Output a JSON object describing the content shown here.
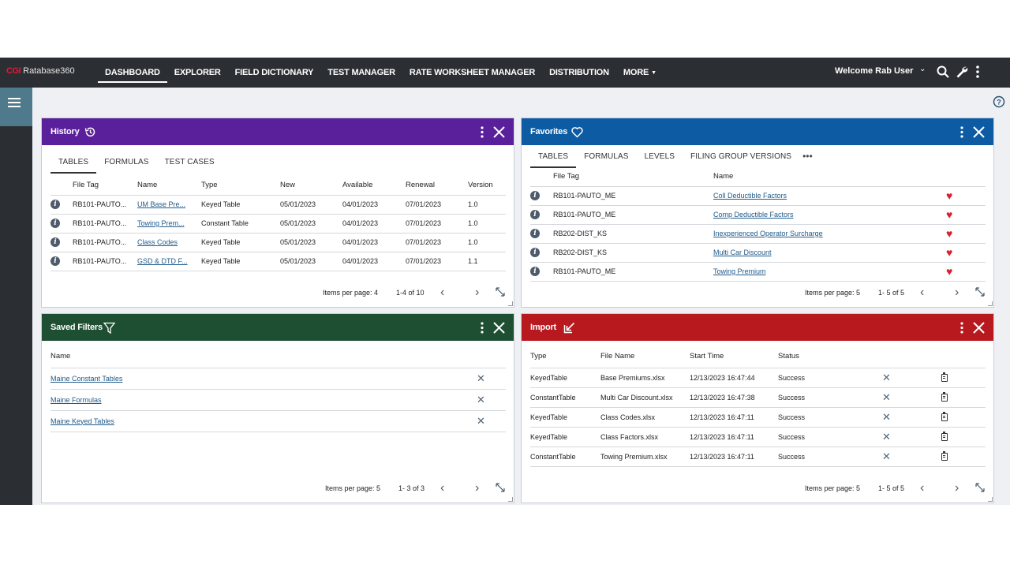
{
  "topbar": {
    "brand_logo": "CGI",
    "brand_name": "Ratabase360",
    "nav": [
      "DASHBOARD",
      "EXPLORER",
      "FIELD DICTIONARY",
      "TEST MANAGER",
      "RATE WORKSHEET MANAGER",
      "DISTRIBUTION",
      "MORE"
    ],
    "active_nav": "DASHBOARD",
    "welcome": "Welcome  Rab User"
  },
  "history": {
    "title": "History",
    "tabs": [
      "TABLES",
      "FORMULAS",
      "TEST CASES"
    ],
    "columns": [
      "File Tag",
      "Name",
      "Type",
      "New",
      "Available",
      "Renewal",
      "Version"
    ],
    "rows": [
      [
        "RB101-PAUTO...",
        "UM Base Pre...",
        "Keyed Table",
        "05/01/2023",
        "04/01/2023",
        "07/01/2023",
        "1.0"
      ],
      [
        "RB101-PAUTO...",
        "Towing Prem...",
        "Constant Table",
        "05/01/2023",
        "04/01/2023",
        "07/01/2023",
        "1.0"
      ],
      [
        "RB101-PAUTO...",
        "Class Codes",
        "Keyed Table",
        "05/01/2023",
        "04/01/2023",
        "07/01/2023",
        "1.0"
      ],
      [
        "RB101-PAUTO...",
        "GSD & DTD F...",
        "Keyed Table",
        "05/01/2023",
        "04/01/2023",
        "07/01/2023",
        "1.1"
      ]
    ],
    "items_per_page": "Items per page: 4",
    "range": "1-4 of 10"
  },
  "favorites": {
    "title": "Favorites",
    "tabs": [
      "TABLES",
      "FORMULAS",
      "LEVELS",
      "FILING GROUP VERSIONS"
    ],
    "more": "•••",
    "columns": [
      "File Tag",
      "Name"
    ],
    "rows": [
      [
        "RB101-PAUTO_ME",
        "Coll Deductible Factors"
      ],
      [
        "RB101-PAUTO_ME",
        "Comp Deductible Factors"
      ],
      [
        "RB202-DIST_KS",
        "Inexperienced Operator Surcharge"
      ],
      [
        "RB202-DIST_KS",
        "Multi Car Discount"
      ],
      [
        "RB101-PAUTO_ME",
        "Towing Premium"
      ]
    ],
    "items_per_page": "Items per page: 5",
    "range": "1- 5 of 5"
  },
  "saved_filters": {
    "title": "Saved Filters",
    "column": "Name",
    "rows": [
      "Maine Constant Tables",
      "Maine Formulas",
      "Maine Keyed Tables"
    ],
    "items_per_page": "Items per page: 5",
    "range": "1- 3 of 3"
  },
  "import": {
    "title": "Import",
    "columns": [
      "Type",
      "File Name",
      "Start Time",
      "Status"
    ],
    "rows": [
      [
        "KeyedTable",
        "Base Premiums.xlsx",
        "12/13/2023 16:47:44",
        "Success"
      ],
      [
        "ConstantTable",
        "Multi Car Discount.xlsx",
        "12/13/2023 16:47:38",
        "Success"
      ],
      [
        "KeyedTable",
        "Class Codes.xlsx",
        "12/13/2023 16:47:11",
        "Success"
      ],
      [
        "KeyedTable",
        "Class Factors.xlsx",
        "12/13/2023 16:47:11",
        "Success"
      ],
      [
        "ConstantTable",
        "Towing Premium.xlsx",
        "12/13/2023 16:47:11",
        "Success"
      ]
    ],
    "items_per_page": "Items per page: 5",
    "range": "1- 5 of 5"
  },
  "colors": {
    "topbar": "#2b2f33",
    "history_header": "#5a1f9a",
    "favorites_header": "#0c5ba3",
    "saved_filters_header": "#1f4f32",
    "import_header": "#b7191f",
    "sidebar_accent": "#4e7a8c",
    "heart": "#d8202f"
  },
  "icons": [
    "menu-icon",
    "history-icon",
    "heart-outline-icon",
    "filter-icon",
    "import-icon",
    "more-vert-icon",
    "close-icon",
    "search-icon",
    "wrench-icon",
    "help-icon",
    "info-icon",
    "heart-icon",
    "clipboard-icon",
    "expand-icon",
    "chevron-left-icon",
    "chevron-right-icon"
  ]
}
